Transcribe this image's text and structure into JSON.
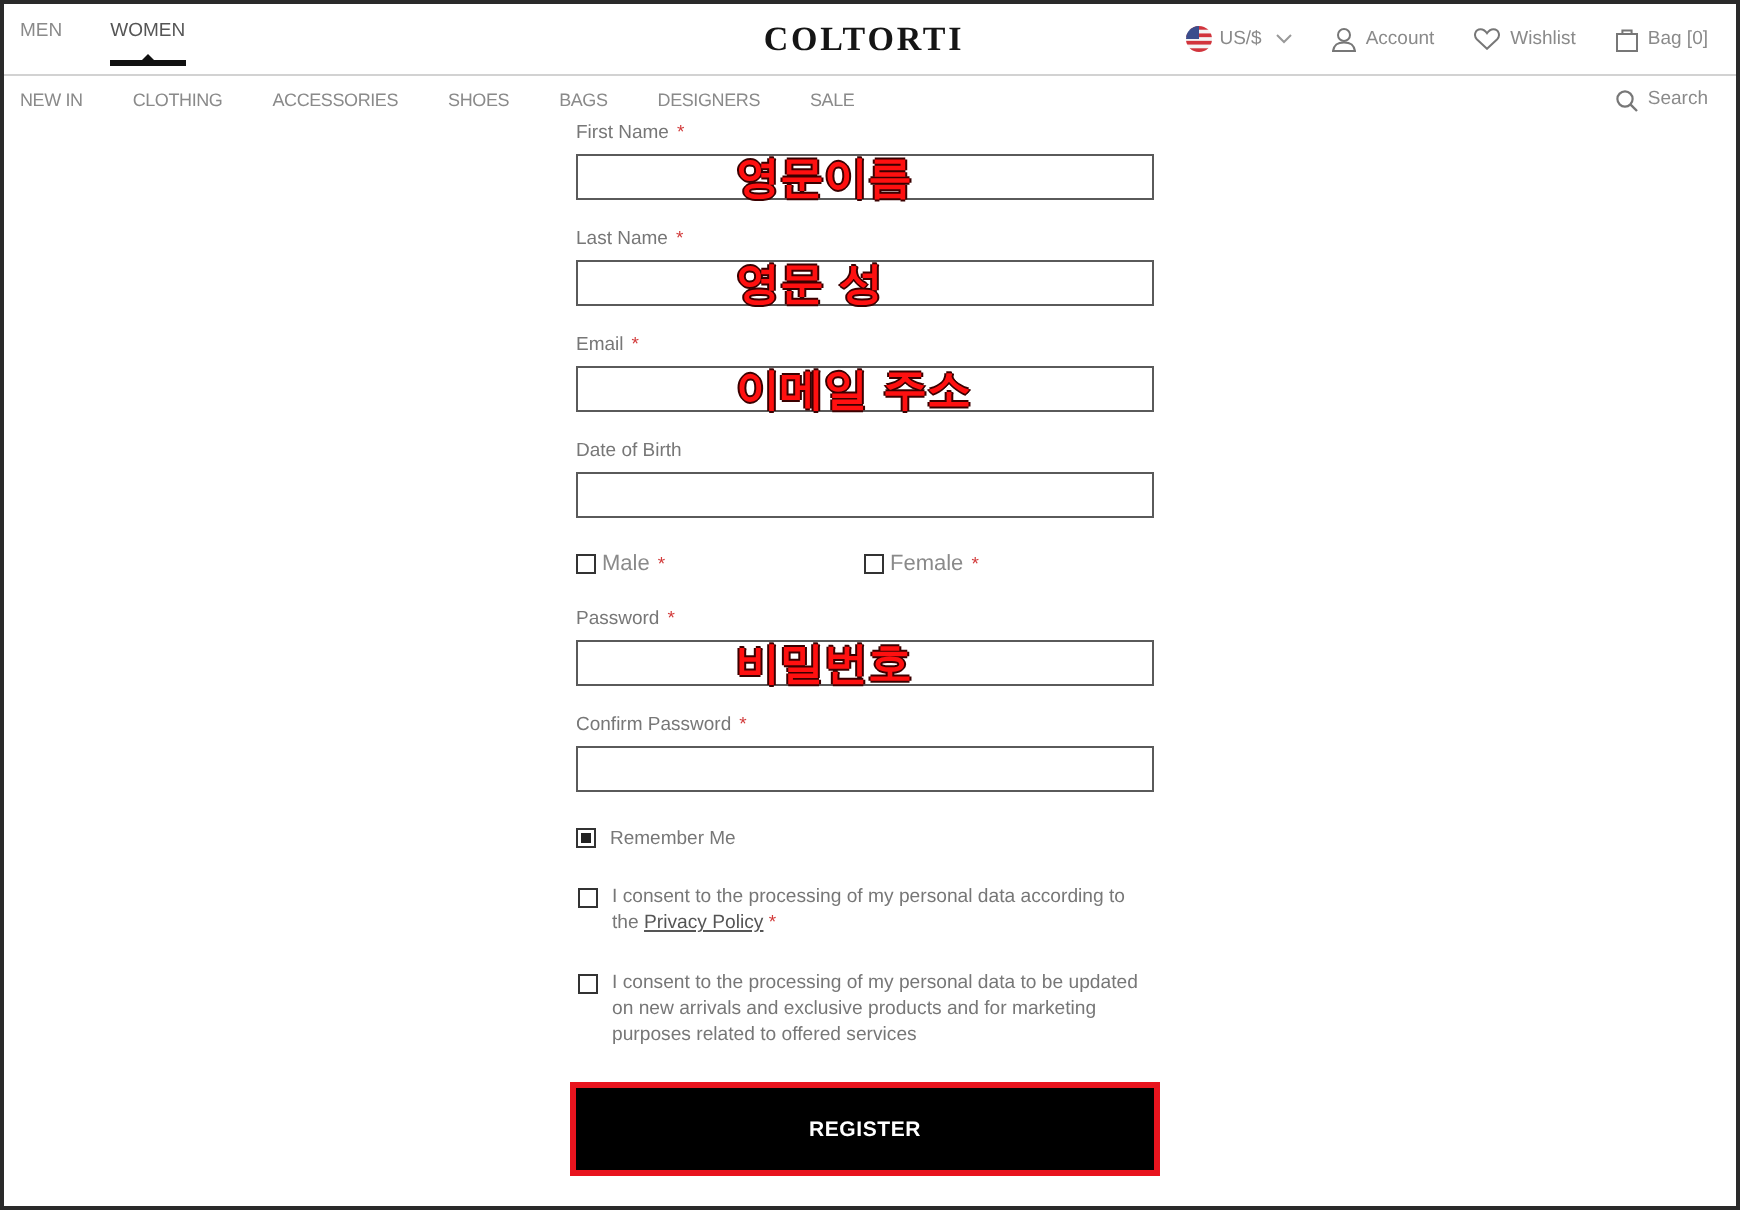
{
  "header": {
    "gender_tabs": [
      {
        "label": "MEN",
        "selected": false
      },
      {
        "label": "WOMEN",
        "selected": true
      }
    ],
    "logo": "COLTORTI",
    "currency": "US/$",
    "account": "Account",
    "wishlist": "Wishlist",
    "bag": "Bag [0]"
  },
  "nav": {
    "items": [
      "NEW IN",
      "CLOTHING",
      "ACCESSORIES",
      "SHOES",
      "BAGS",
      "DESIGNERS",
      "SALE"
    ],
    "search": "Search"
  },
  "form": {
    "fields": [
      {
        "kind": "text",
        "label": "First Name",
        "required_mark": "*",
        "annotation": "영문이름"
      },
      {
        "kind": "text",
        "label": "Last Name",
        "required_mark": "*",
        "annotation": "영문 성"
      },
      {
        "kind": "text",
        "label": "Email",
        "required_mark": "*",
        "annotation": "이메일 주소"
      },
      {
        "kind": "text",
        "label": "Date of Birth"
      },
      {
        "kind": "options",
        "options": [
          {
            "label": "Male",
            "required_mark": "*",
            "checked": false
          },
          {
            "label": "Female",
            "required_mark": "*",
            "checked": false
          }
        ]
      },
      {
        "kind": "text",
        "label": "Password",
        "required_mark": "*",
        "annotation": "비밀번호"
      },
      {
        "kind": "text",
        "label": "Confirm Password",
        "required_mark": "*"
      },
      {
        "kind": "checkbox",
        "label": "Remember Me",
        "checked": true
      },
      {
        "kind": "consent",
        "text": "I consent to the processing of my personal data according to the",
        "link": "Privacy Policy",
        "required_mark": "*",
        "checked": false
      },
      {
        "kind": "consent",
        "text": "I consent to the processing of my personal data to be updated on new arrivals and exclusive products and for marketing purposes related to offered services",
        "checked": false
      }
    ],
    "register": {
      "label": "REGISTER",
      "highlighted": true
    }
  }
}
